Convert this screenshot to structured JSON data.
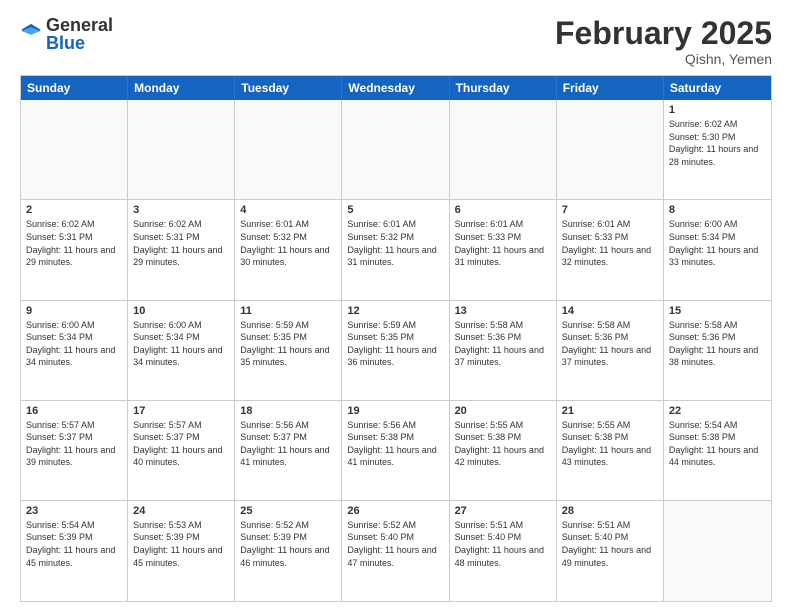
{
  "header": {
    "logo_general": "General",
    "logo_blue": "Blue",
    "month_title": "February 2025",
    "location": "Qishn, Yemen"
  },
  "weekdays": [
    "Sunday",
    "Monday",
    "Tuesday",
    "Wednesday",
    "Thursday",
    "Friday",
    "Saturday"
  ],
  "weeks": [
    [
      {
        "day": "",
        "info": ""
      },
      {
        "day": "",
        "info": ""
      },
      {
        "day": "",
        "info": ""
      },
      {
        "day": "",
        "info": ""
      },
      {
        "day": "",
        "info": ""
      },
      {
        "day": "",
        "info": ""
      },
      {
        "day": "1",
        "info": "Sunrise: 6:02 AM\nSunset: 5:30 PM\nDaylight: 11 hours and 28 minutes."
      }
    ],
    [
      {
        "day": "2",
        "info": "Sunrise: 6:02 AM\nSunset: 5:31 PM\nDaylight: 11 hours and 29 minutes."
      },
      {
        "day": "3",
        "info": "Sunrise: 6:02 AM\nSunset: 5:31 PM\nDaylight: 11 hours and 29 minutes."
      },
      {
        "day": "4",
        "info": "Sunrise: 6:01 AM\nSunset: 5:32 PM\nDaylight: 11 hours and 30 minutes."
      },
      {
        "day": "5",
        "info": "Sunrise: 6:01 AM\nSunset: 5:32 PM\nDaylight: 11 hours and 31 minutes."
      },
      {
        "day": "6",
        "info": "Sunrise: 6:01 AM\nSunset: 5:33 PM\nDaylight: 11 hours and 31 minutes."
      },
      {
        "day": "7",
        "info": "Sunrise: 6:01 AM\nSunset: 5:33 PM\nDaylight: 11 hours and 32 minutes."
      },
      {
        "day": "8",
        "info": "Sunrise: 6:00 AM\nSunset: 5:34 PM\nDaylight: 11 hours and 33 minutes."
      }
    ],
    [
      {
        "day": "9",
        "info": "Sunrise: 6:00 AM\nSunset: 5:34 PM\nDaylight: 11 hours and 34 minutes."
      },
      {
        "day": "10",
        "info": "Sunrise: 6:00 AM\nSunset: 5:34 PM\nDaylight: 11 hours and 34 minutes."
      },
      {
        "day": "11",
        "info": "Sunrise: 5:59 AM\nSunset: 5:35 PM\nDaylight: 11 hours and 35 minutes."
      },
      {
        "day": "12",
        "info": "Sunrise: 5:59 AM\nSunset: 5:35 PM\nDaylight: 11 hours and 36 minutes."
      },
      {
        "day": "13",
        "info": "Sunrise: 5:58 AM\nSunset: 5:36 PM\nDaylight: 11 hours and 37 minutes."
      },
      {
        "day": "14",
        "info": "Sunrise: 5:58 AM\nSunset: 5:36 PM\nDaylight: 11 hours and 37 minutes."
      },
      {
        "day": "15",
        "info": "Sunrise: 5:58 AM\nSunset: 5:36 PM\nDaylight: 11 hours and 38 minutes."
      }
    ],
    [
      {
        "day": "16",
        "info": "Sunrise: 5:57 AM\nSunset: 5:37 PM\nDaylight: 11 hours and 39 minutes."
      },
      {
        "day": "17",
        "info": "Sunrise: 5:57 AM\nSunset: 5:37 PM\nDaylight: 11 hours and 40 minutes."
      },
      {
        "day": "18",
        "info": "Sunrise: 5:56 AM\nSunset: 5:37 PM\nDaylight: 11 hours and 41 minutes."
      },
      {
        "day": "19",
        "info": "Sunrise: 5:56 AM\nSunset: 5:38 PM\nDaylight: 11 hours and 41 minutes."
      },
      {
        "day": "20",
        "info": "Sunrise: 5:55 AM\nSunset: 5:38 PM\nDaylight: 11 hours and 42 minutes."
      },
      {
        "day": "21",
        "info": "Sunrise: 5:55 AM\nSunset: 5:38 PM\nDaylight: 11 hours and 43 minutes."
      },
      {
        "day": "22",
        "info": "Sunrise: 5:54 AM\nSunset: 5:38 PM\nDaylight: 11 hours and 44 minutes."
      }
    ],
    [
      {
        "day": "23",
        "info": "Sunrise: 5:54 AM\nSunset: 5:39 PM\nDaylight: 11 hours and 45 minutes."
      },
      {
        "day": "24",
        "info": "Sunrise: 5:53 AM\nSunset: 5:39 PM\nDaylight: 11 hours and 45 minutes."
      },
      {
        "day": "25",
        "info": "Sunrise: 5:52 AM\nSunset: 5:39 PM\nDaylight: 11 hours and 46 minutes."
      },
      {
        "day": "26",
        "info": "Sunrise: 5:52 AM\nSunset: 5:40 PM\nDaylight: 11 hours and 47 minutes."
      },
      {
        "day": "27",
        "info": "Sunrise: 5:51 AM\nSunset: 5:40 PM\nDaylight: 11 hours and 48 minutes."
      },
      {
        "day": "28",
        "info": "Sunrise: 5:51 AM\nSunset: 5:40 PM\nDaylight: 11 hours and 49 minutes."
      },
      {
        "day": "",
        "info": ""
      }
    ]
  ]
}
